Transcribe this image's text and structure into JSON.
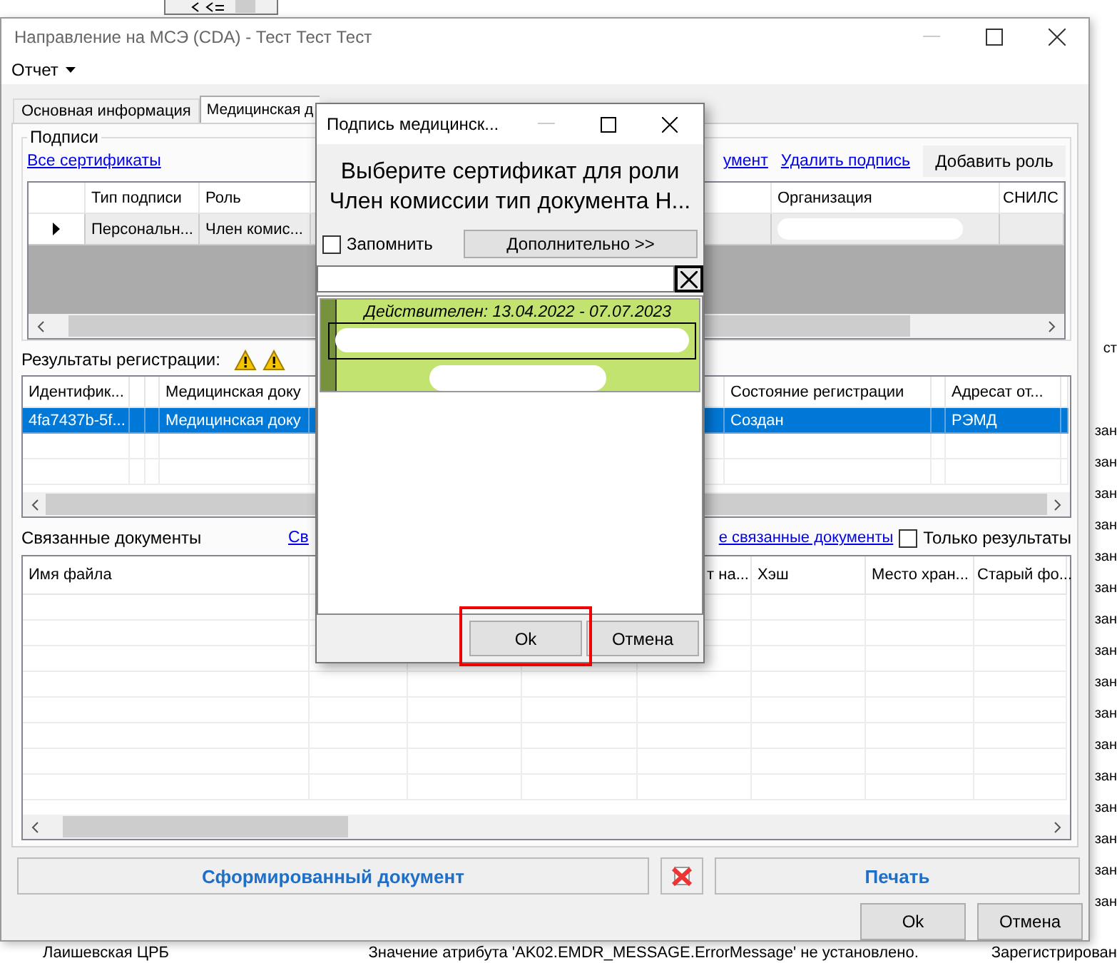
{
  "background": {
    "side_texts": [
      "ст",
      "зан",
      "зан",
      "зан",
      "зан",
      "зан",
      "зан",
      "зан",
      "зан",
      "зан",
      "зан",
      "зан",
      "зан",
      "зан",
      "зан",
      "зан",
      "зан"
    ],
    "bottom_texts": [
      "Лаишевская ЦРБ",
      "Значение атрибута 'AK02.EMDR_MESSAGE.ErrorMessage' не установлено.",
      "Зарегистрирован"
    ]
  },
  "window": {
    "title": "Направление на МСЭ (CDA) - Тест Тест Тест"
  },
  "menu": [
    {
      "label": "Отчет"
    }
  ],
  "tabs": [
    {
      "label": "Основная информация",
      "selected": false
    },
    {
      "label": "Медицинская д",
      "selected": true
    }
  ],
  "signatures": {
    "title": "Подписи",
    "all_link": "Все сертификаты",
    "links": [
      "умент",
      "Удалить подпись"
    ],
    "add_button": "Добавить роль",
    "columns": [
      {
        "label": "Тип подписи"
      },
      {
        "label": "Роль"
      },
      {
        "label": "Организация"
      },
      {
        "label": "СНИЛС"
      }
    ],
    "rows": [
      {
        "current": true,
        "cells": [
          "Персональн...",
          "Член комис..."
        ]
      }
    ]
  },
  "results": {
    "title": "Результаты регистрации:",
    "columns": [
      {
        "label": "Идентифик..."
      },
      {
        "label": "Медицинская доку"
      },
      {
        "label": "Состояние регистрации"
      },
      {
        "label": "Адресат от..."
      }
    ],
    "rows": [
      {
        "selected": true,
        "cells": [
          "4fa7437b-5f...",
          "Медицинская доку",
          "Создан",
          "РЭМД"
        ]
      }
    ]
  },
  "related": {
    "title": "Связанные документы",
    "link_left": "Св",
    "link_right": "е связанные документы",
    "only_results": {
      "label": "Только результаты",
      "checked": false
    },
    "columns": [
      {
        "label": "Имя файла"
      },
      {
        "label": "т на..."
      },
      {
        "label": "Хэш"
      },
      {
        "label": "Место хран..."
      },
      {
        "label": "Старый фо..."
      }
    ]
  },
  "buttons": {
    "document": "Сформированный документ",
    "print": "Печать",
    "ok": "Ok",
    "cancel": "Отмена"
  },
  "dialog": {
    "title": "Подпись медицинск...",
    "prompt_lines": [
      "Выберите сертификат для роли",
      "Член комиссии тип документа Н..."
    ],
    "remember": {
      "label": "Запомнить",
      "checked": false
    },
    "more_button": "Дополнительно >>",
    "certificates": [
      {
        "validity": "Действителен: 13.04.2022 - 07.07.2023",
        "selected": true
      }
    ],
    "ok_button": "Ok",
    "cancel_button": "Отмена"
  }
}
